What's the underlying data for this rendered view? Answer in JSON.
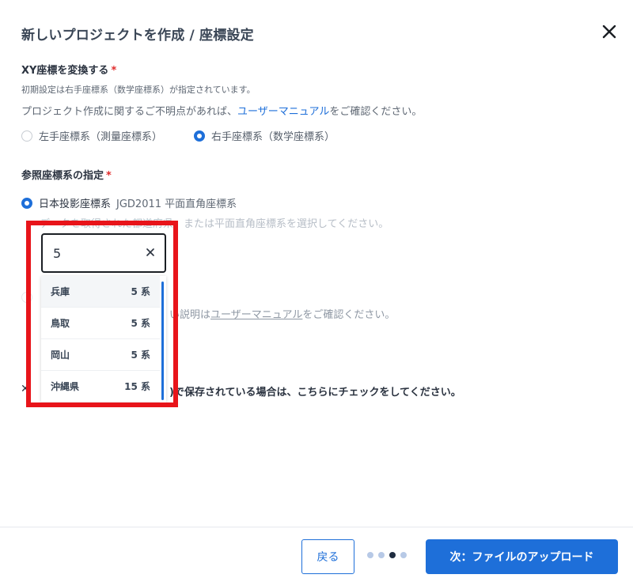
{
  "header": {
    "title": "新しいプロジェクトを作成 / 座標設定"
  },
  "xy_section": {
    "label": "XY座標を変換する",
    "required_mark": "*",
    "default_note": "初期設定は右手座標系（数学座標系）が指定されています。",
    "help_prefix": "プロジェクト作成に関するご不明点があれば、",
    "help_link": "ユーザーマニュアル",
    "help_suffix": "をご確認ください。",
    "options": [
      {
        "label": "左手座標系（測量座標系）",
        "selected": false
      },
      {
        "label": "右手座標系（数学座標系）",
        "selected": true
      }
    ]
  },
  "ref_section": {
    "label": "参照座標系の指定",
    "required_mark": "*",
    "option1_label": "日本投影座標系",
    "option1_detail": "JGD2011 平面直角座標系",
    "option1_hint": "データを取得された都道府県、または平面直角座標系を選択してください。",
    "option2_hint_prefix": "い説明は",
    "option2_link": "ユーザーマニュアル",
    "option2_hint_suffix": "をご確認ください。",
    "checkbox_partial": ")で保存されている場合は、こちらにチェックをしてください。"
  },
  "dropdown": {
    "search_value": "5",
    "items": [
      {
        "name": "兵庫",
        "system": "5 系"
      },
      {
        "name": "鳥取",
        "system": "5 系"
      },
      {
        "name": "岡山",
        "system": "5 系"
      },
      {
        "name": "沖縄県",
        "system": "15 系"
      }
    ]
  },
  "footer": {
    "back_label": "戻る",
    "next_label": "次：ファイルのアップロード",
    "steps_total": 4,
    "current_step": 3
  },
  "colors": {
    "accent": "#1e6fd9",
    "required": "#e02b2b",
    "highlight_frame": "#e8141a"
  }
}
